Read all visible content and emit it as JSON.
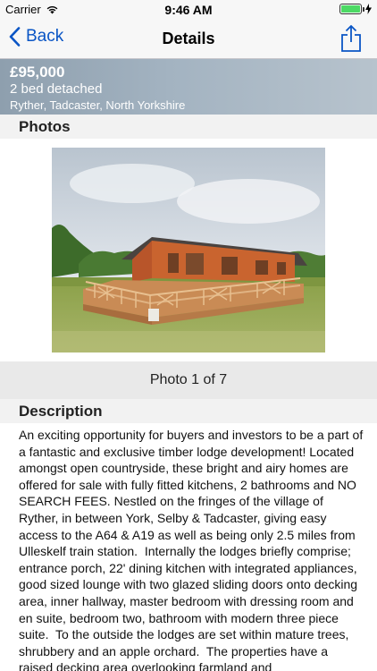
{
  "status_bar": {
    "carrier": "Carrier",
    "time": "9:46 AM",
    "battery_level": 1.0
  },
  "nav": {
    "back_label": "Back",
    "title": "Details"
  },
  "listing": {
    "price": "£95,000",
    "type": "2 bed detached",
    "location": "Ryther, Tadcaster, North Yorkshire"
  },
  "photos": {
    "header": "Photos",
    "counter": "Photo 1 of 7"
  },
  "description": {
    "header": "Description",
    "text": "An exciting opportunity for buyers and investors to be a part of a fantastic and exclusive timber lodge development! Located amongst open countryside, these bright and airy homes are offered for sale with fully fitted kitchens, 2 bathrooms and NO SEARCH FEES. Nestled on the fringes of the village of Ryther, in between York, Selby & Tadcaster, giving easy access to the A64 & A19 as well as being only 2.5 miles from Ulleskelf train station.  Internally the lodges briefly comprise; entrance porch, 22' dining kitchen with integrated appliances, good sized lounge with two glazed sliding doors onto decking area, inner hallway, master bedroom with dressing room and en suite, bedroom two, bathroom with modern three piece suite.  To the outside the lodges are set within mature trees, shrubbery and an apple orchard.  The properties have a raised decking area overlooking farmland and"
  },
  "colors": {
    "accent": "#0a55c5",
    "battery": "#4cd964"
  }
}
